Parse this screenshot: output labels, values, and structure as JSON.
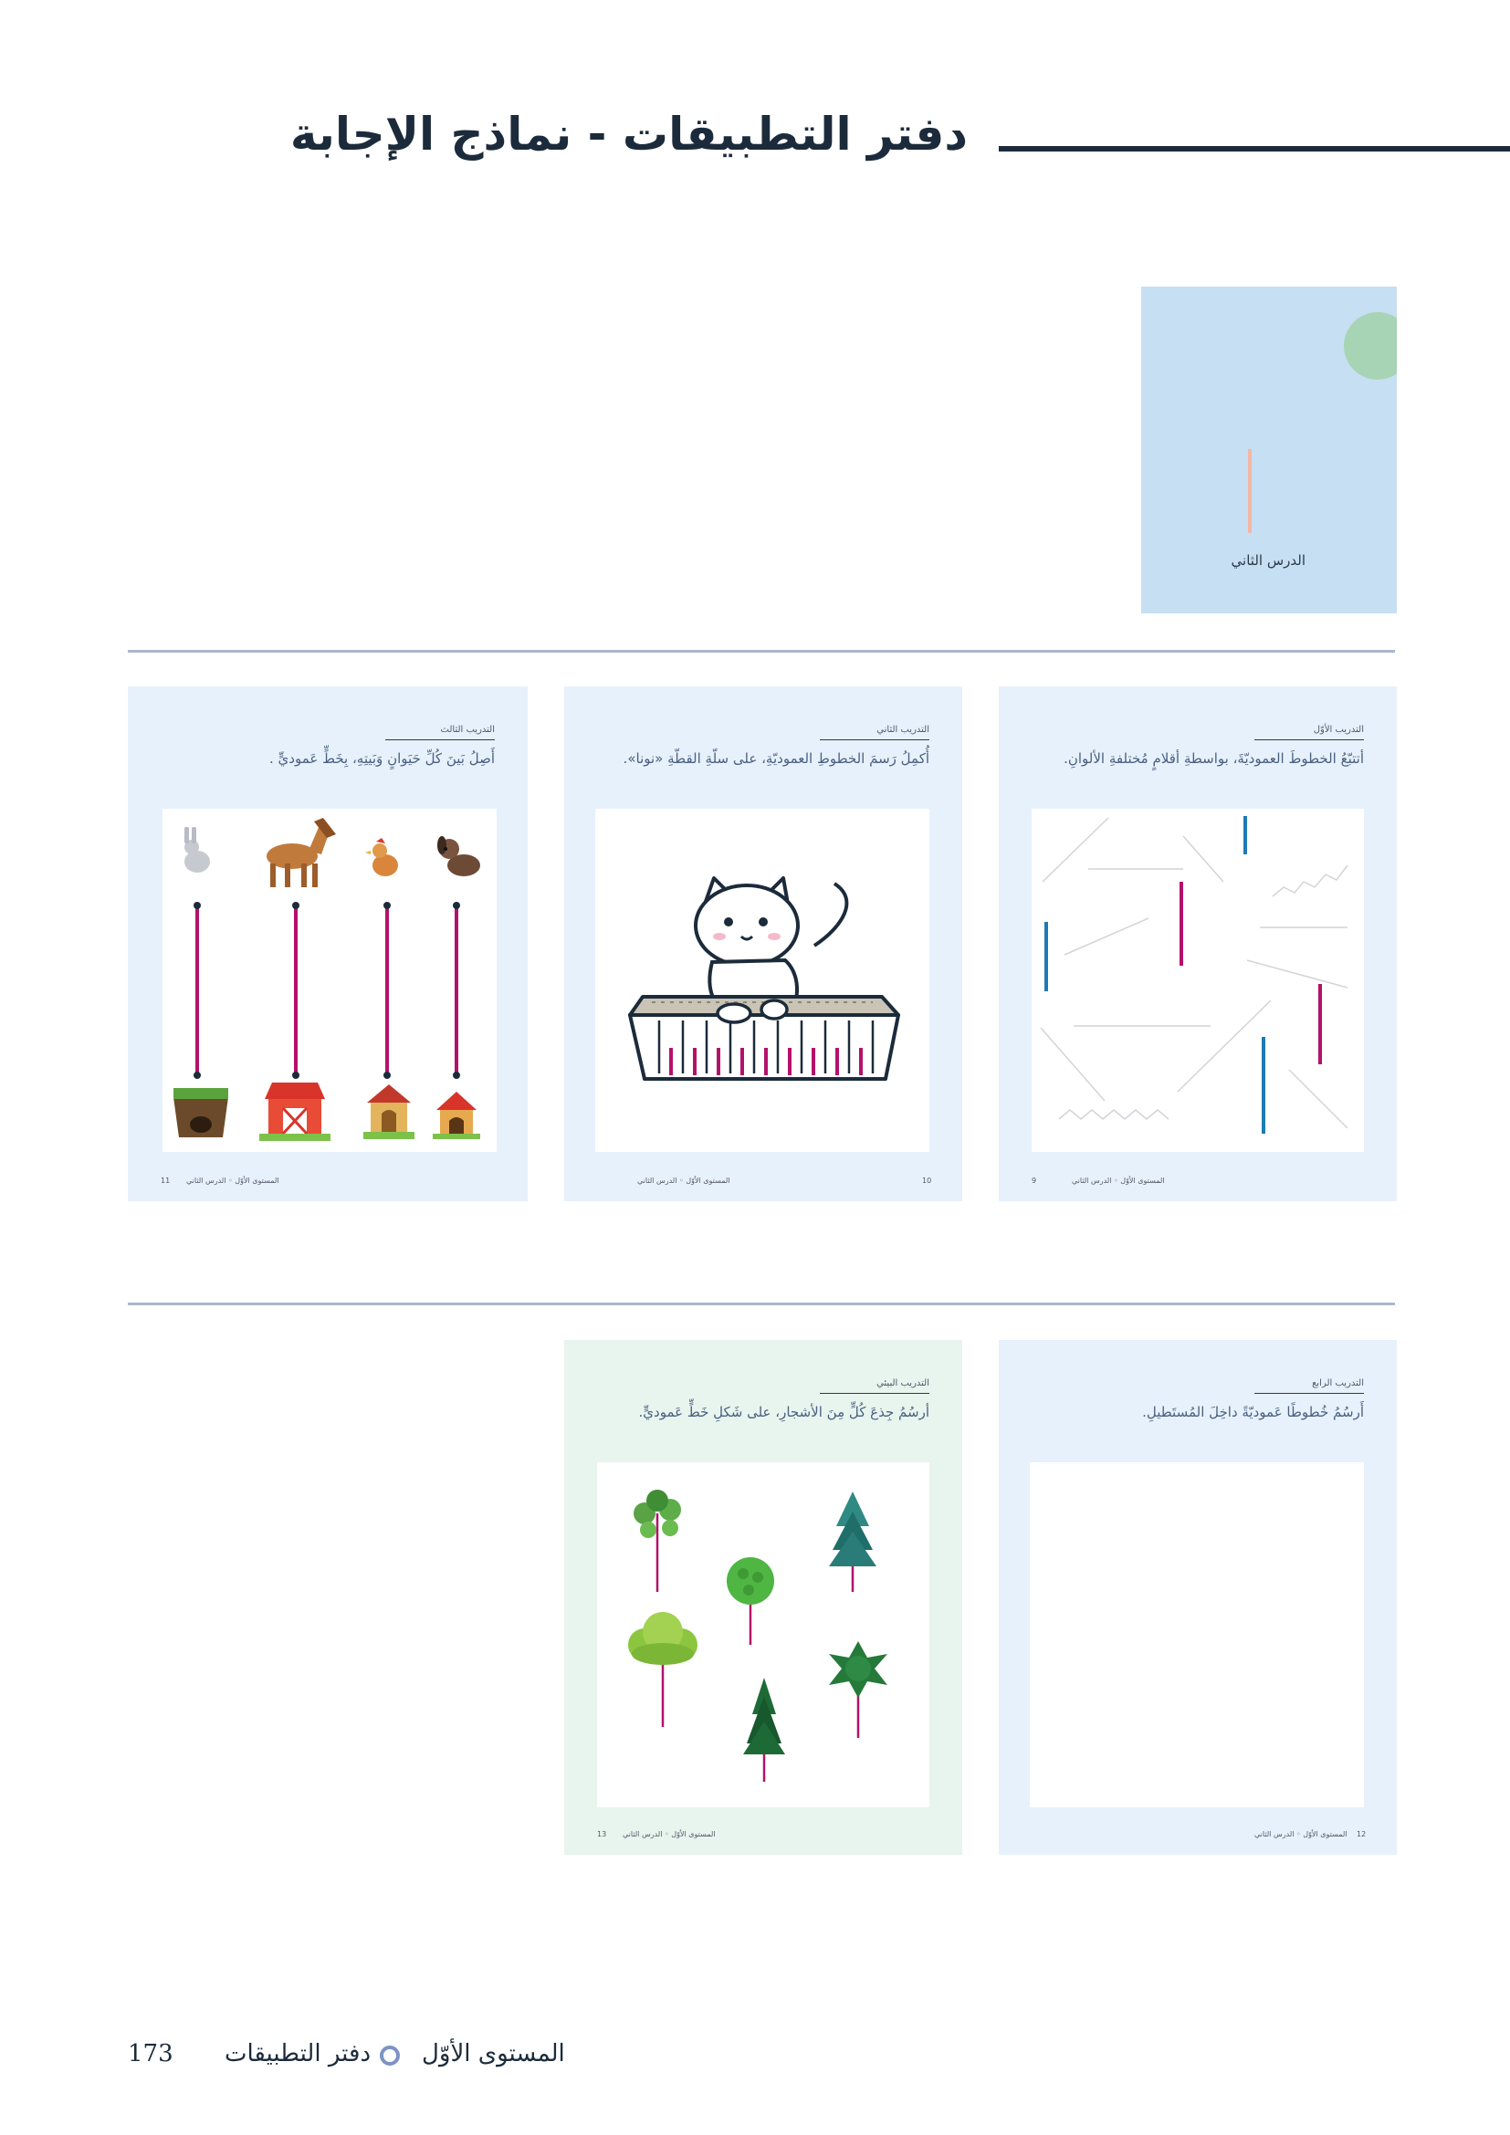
{
  "header": {
    "title": "دفتر التطبيقات - نماذج الإجابة"
  },
  "lesson_cover": {
    "label": "الدرس الثاني"
  },
  "cards": [
    {
      "tag": "التدريب الأوّل",
      "instruction": "أتتبّعُ الخطوطَ العموديّةَ، بواسطةِ أقلامٍ مُختلفةِ الألوانِ.",
      "footer_level": "المستوى الأوّل",
      "footer_lesson": "الدرس الثاني",
      "page": "9"
    },
    {
      "tag": "التدريب الثاني",
      "instruction": "أُكمِلُ رَسمَ الخطوطِ العموديّةِ، على سلّةِ القطّةِ «نونا».",
      "footer_level": "المستوى الأوّل",
      "footer_lesson": "الدرس الثاني",
      "page": "10"
    },
    {
      "tag": "التدريب الثالث",
      "instruction": "أَصِلُ بَينَ كُلِّ حَيَوانٍ وَبَيتِهِ، بِخَطٍّ عَموديٍّ .",
      "footer_level": "المستوى الأوّل",
      "footer_lesson": "الدرس الثاني",
      "page": "11"
    },
    {
      "tag": "التدريب الرابع",
      "instruction": "أَرسُمُ خُطوطًا عَموديّةً داخِلَ المُستَطيلِ.",
      "footer_level": "المستوى الأوّل",
      "footer_lesson": "الدرس الثاني",
      "page": "12"
    },
    {
      "tag": "التدريب البيئي",
      "instruction": "أرسُمُ جِذعَ كُلٍّ مِنَ الأشجارِ، على شَكلِ خَطٍّ عَموديٍّ.",
      "footer_level": "المستوى الأوّل",
      "footer_lesson": "الدرس الثاني",
      "page": "13"
    }
  ],
  "footer": {
    "level": "المستوى الأوّل",
    "book": "دفتر التطبيقات",
    "page_number": "173"
  },
  "colors": {
    "card_blue": "#e7f1fc",
    "card_green": "#e8f4ee",
    "cover_blue": "#c6dff2",
    "cover_dot": "#a6d4b4",
    "trace_pink": "#b3126a",
    "trace_blue": "#1d7ab5",
    "title": "#1c2b3b"
  }
}
